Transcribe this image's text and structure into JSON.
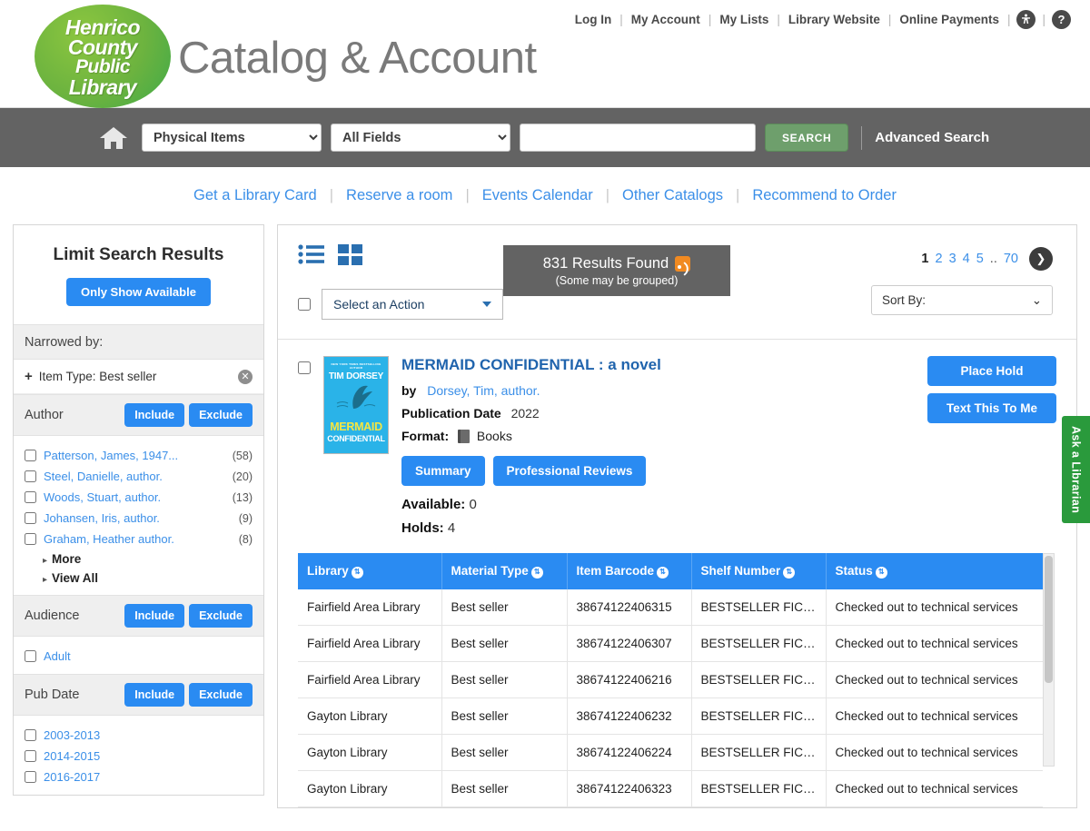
{
  "header": {
    "logo_lines": [
      "Henrico",
      "County",
      "Public",
      "Library"
    ],
    "site_title": "Catalog & Account",
    "topnav": [
      {
        "label": "Log In"
      },
      {
        "label": "My Account"
      },
      {
        "label": "My Lists"
      },
      {
        "label": "Library Website"
      },
      {
        "label": "Online Payments"
      }
    ],
    "accessibility_icon": "accessibility-icon",
    "help_icon": "help-icon",
    "help_glyph": "?"
  },
  "searchbar": {
    "home_icon": "home-icon",
    "format_selected": "Physical Items",
    "format_options": [
      "Physical Items"
    ],
    "field_selected": "All Fields",
    "field_options": [
      "All Fields"
    ],
    "query": "",
    "query_placeholder": "",
    "search_button": "SEARCH",
    "advanced_search": "Advanced Search"
  },
  "quicklinks": [
    {
      "label": "Get a Library Card"
    },
    {
      "label": "Reserve a room"
    },
    {
      "label": "Events Calendar"
    },
    {
      "label": "Other Catalogs"
    },
    {
      "label": "Recommend to Order"
    }
  ],
  "sidebar": {
    "title": "Limit Search Results",
    "only_show_available": "Only Show Available",
    "narrowed_by_label": "Narrowed by:",
    "narrowed_items": [
      {
        "label": "Item Type: Best seller",
        "plus": "+",
        "remove_icon": "remove-icon"
      }
    ],
    "facets": [
      {
        "name": "Author",
        "include": "Include",
        "exclude": "Exclude",
        "options": [
          {
            "label": "Patterson, James, 1947...",
            "count": "(58)"
          },
          {
            "label": "Steel, Danielle, author.",
            "count": "(20)"
          },
          {
            "label": "Woods, Stuart, author.",
            "count": "(13)"
          },
          {
            "label": "Johansen, Iris, author.",
            "count": "(9)"
          },
          {
            "label": "Graham, Heather author.",
            "count": "(8)"
          }
        ],
        "more": "More",
        "view_all": "View All"
      },
      {
        "name": "Audience",
        "include": "Include",
        "exclude": "Exclude",
        "options": [
          {
            "label": "Adult",
            "count": ""
          }
        ]
      },
      {
        "name": "Pub Date",
        "include": "Include",
        "exclude": "Exclude",
        "options": [
          {
            "label": "2003-2013",
            "count": ""
          },
          {
            "label": "2014-2015",
            "count": ""
          },
          {
            "label": "2016-2017",
            "count": ""
          }
        ]
      }
    ]
  },
  "results": {
    "view_list_icon": "list-view-icon",
    "view_grid_icon": "grid-view-icon",
    "count_text": "831 Results Found",
    "rss_icon": "rss-icon",
    "grouped_note": "(Some may be grouped)",
    "pagination": {
      "pages": [
        "1",
        "2",
        "3",
        "4",
        "5"
      ],
      "dots": "..",
      "last": "70",
      "current": "1",
      "next_icon": "next-page-icon"
    },
    "action_select": "Select an Action",
    "sort_by": "Sort By:"
  },
  "record": {
    "title": "MERMAID CONFIDENTIAL : a novel",
    "by_label": "by",
    "author": "Dorsey, Tim, author.",
    "pub_date_label": "Publication Date",
    "pub_date": "2022",
    "format_label": "Format:",
    "format_icon": "book-icon",
    "format_value": "Books",
    "tabs": [
      {
        "label": "Summary"
      },
      {
        "label": "Professional Reviews"
      }
    ],
    "available_label": "Available:",
    "available_value": "0",
    "holds_label": "Holds:",
    "holds_value": "4",
    "actions": [
      {
        "label": "Place Hold"
      },
      {
        "label": "Text This To Me"
      }
    ],
    "cover": {
      "blurb": "NEW YORK TIMES BESTSELLING AUTHOR",
      "author": "TIM DORSEY",
      "title": "MERMAID",
      "subtitle": "CONFIDENTIAL",
      "bg_color": "#2ab3e8",
      "title_color": "#f5e642"
    }
  },
  "holdings": {
    "columns": [
      "Library",
      "Material Type",
      "Item Barcode",
      "Shelf Number",
      "Status"
    ],
    "sort_icon": "sort-icon",
    "rows": [
      [
        "Fairfield Area Library",
        "Best seller",
        "38674122406315",
        "BESTSELLER FICTION",
        "Checked out to technical services"
      ],
      [
        "Fairfield Area Library",
        "Best seller",
        "38674122406307",
        "BESTSELLER FICTION",
        "Checked out to technical services"
      ],
      [
        "Fairfield Area Library",
        "Best seller",
        "38674122406216",
        "BESTSELLER FICTION",
        "Checked out to technical services"
      ],
      [
        "Gayton Library",
        "Best seller",
        "38674122406232",
        "BESTSELLER FICTION",
        "Checked out to technical services"
      ],
      [
        "Gayton Library",
        "Best seller",
        "38674122406224",
        "BESTSELLER FICTION",
        "Checked out to technical services"
      ],
      [
        "Gayton Library",
        "Best seller",
        "38674122406323",
        "BESTSELLER FICTION",
        "Checked out to technical services"
      ]
    ]
  },
  "ask_librarian": "Ask a Librarian",
  "colors": {
    "brand_green": "#3faa49",
    "accent_blue": "#2a8bf2",
    "link_blue": "#3b8fe8",
    "bar_gray": "#636363",
    "search_green": "#6e9f6c",
    "rss_orange": "#f18a21",
    "librarian_green": "#2a9a3c"
  }
}
